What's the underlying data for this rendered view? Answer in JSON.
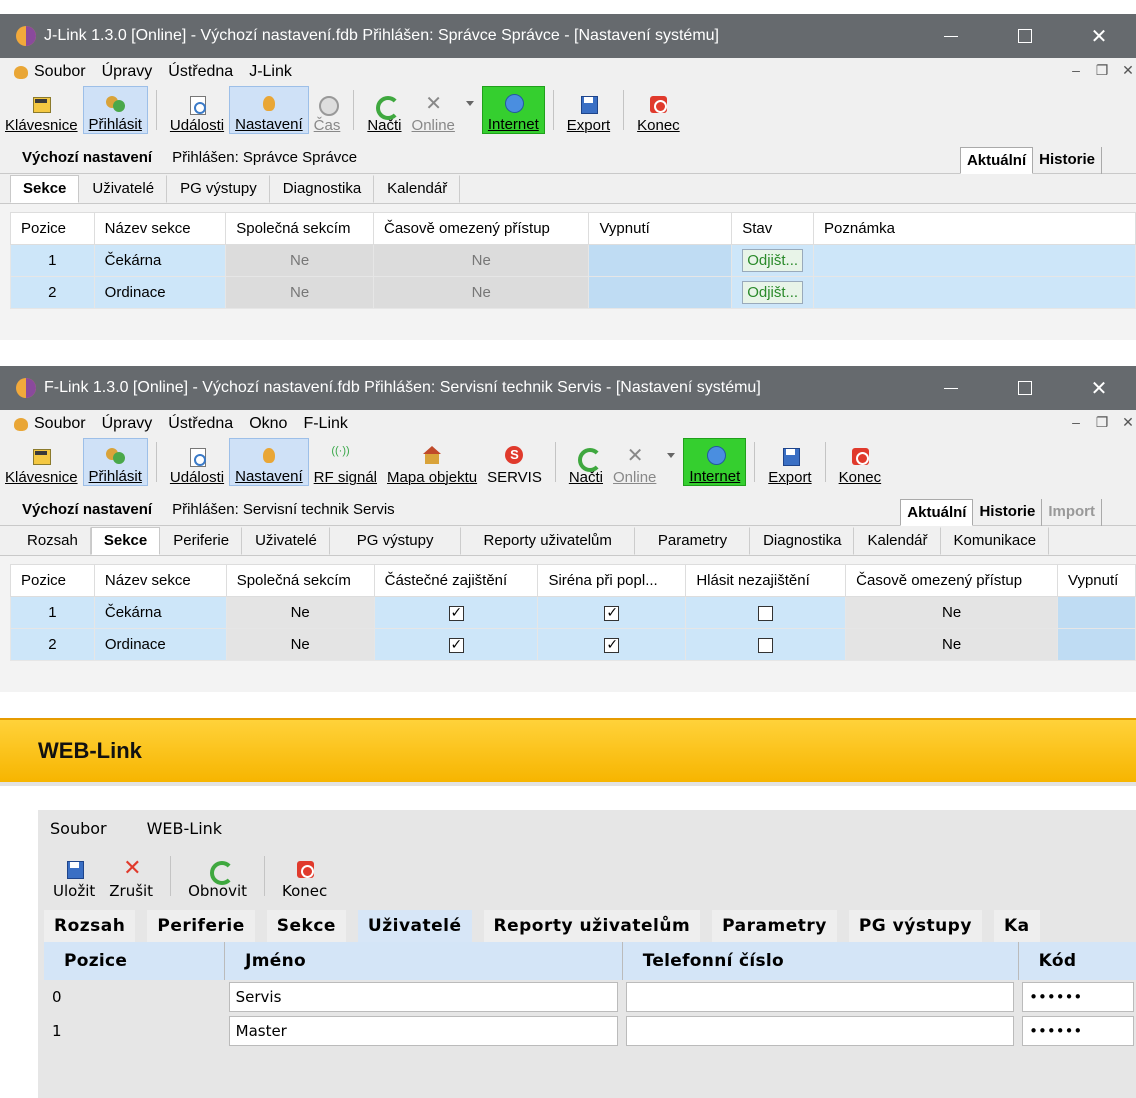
{
  "jlink": {
    "title": "J-Link 1.3.0 [Online] - Výchozí nastavení.fdb Přihlášen: Správce Správce - [Nastavení systému]",
    "menu": [
      "Soubor",
      "Úpravy",
      "Ústředna",
      "J-Link"
    ],
    "toolbar": {
      "keyboard": "Klávesnice",
      "login": "Přihlásit",
      "events": "Události",
      "settings": "Nastavení",
      "time": "Čas",
      "load": "Načti",
      "online": "Online",
      "internet": "Internet",
      "export": "Export",
      "quit": "Konec"
    },
    "db_name": "Výchozí nastavení",
    "logged_in": "Přihlášen: Správce Správce",
    "view_tabs": [
      "Aktuální",
      "Historie"
    ],
    "tabs": [
      "Sekce",
      "Uživatelé",
      "PG výstupy",
      "Diagnostika",
      "Kalendář"
    ],
    "columns": [
      "Pozice",
      "Název sekce",
      "Společná sekcím",
      "Časově omezený přístup",
      "Vypnutí",
      "Stav",
      "Poznámka"
    ],
    "rows": [
      {
        "pos": "1",
        "name": "Čekárna",
        "shared": "Ne",
        "timed": "Ne",
        "status": "Odjišt..."
      },
      {
        "pos": "2",
        "name": "Ordinace",
        "shared": "Ne",
        "timed": "Ne",
        "status": "Odjišt..."
      }
    ]
  },
  "flink": {
    "title": "F-Link 1.3.0 [Online] - Výchozí nastavení.fdb Přihlášen: Servisní technik Servis - [Nastavení systému]",
    "menu": [
      "Soubor",
      "Úpravy",
      "Ústředna",
      "Okno",
      "F-Link"
    ],
    "toolbar": {
      "keyboard": "Klávesnice",
      "login": "Přihlásit",
      "events": "Události",
      "settings": "Nastavení",
      "rf": "RF signál",
      "map": "Mapa objektu",
      "servis": "SERVIS",
      "load": "Načti",
      "online": "Online",
      "internet": "Internet",
      "export": "Export",
      "quit": "Konec"
    },
    "db_name": "Výchozí nastavení",
    "logged_in": "Přihlášen: Servisní technik Servis",
    "view_tabs": [
      "Aktuální",
      "Historie",
      "Import"
    ],
    "tabs": [
      "Rozsah",
      "Sekce",
      "Periferie",
      "Uživatelé",
      "PG výstupy",
      "Reporty uživatelům",
      "Parametry",
      "Diagnostika",
      "Kalendář",
      "Komunikace"
    ],
    "columns": [
      "Pozice",
      "Název sekce",
      "Společná sekcím",
      "Částečné zajištění",
      "Siréna při popl...",
      "Hlásit nezajištění",
      "Časově omezený přístup",
      "Vypnutí"
    ],
    "rows": [
      {
        "pos": "1",
        "name": "Čekárna",
        "shared": "Ne",
        "partial": true,
        "siren": true,
        "report": false,
        "timed": "Ne"
      },
      {
        "pos": "2",
        "name": "Ordinace",
        "shared": "Ne",
        "partial": true,
        "siren": true,
        "report": false,
        "timed": "Ne"
      }
    ]
  },
  "weblink": {
    "header": "WEB-Link",
    "menu": [
      "Soubor",
      "WEB-Link"
    ],
    "toolbar": {
      "save": "Uložit",
      "cancel": "Zrušit",
      "refresh": "Obnovit",
      "quit": "Konec"
    },
    "tabs": [
      "Rozsah",
      "Periferie",
      "Sekce",
      "Uživatelé",
      "Reporty uživatelům",
      "Parametry",
      "PG výstupy",
      "Ka"
    ],
    "columns": [
      "Pozice",
      "Jméno",
      "Telefonní číslo",
      "Kód"
    ],
    "rows": [
      {
        "pos": "0",
        "name": "Servis",
        "phone": "",
        "code": "••••••"
      },
      {
        "pos": "1",
        "name": "Master",
        "phone": "",
        "code": "••••••"
      }
    ]
  }
}
